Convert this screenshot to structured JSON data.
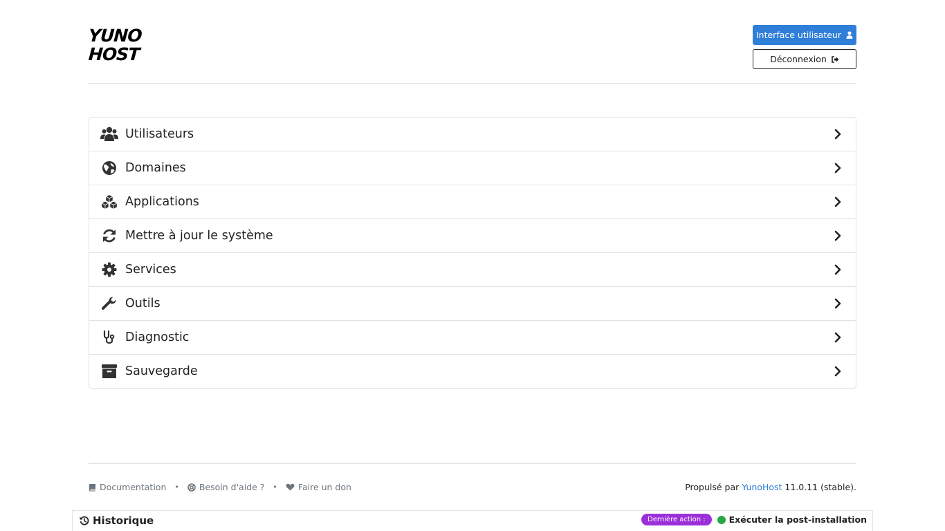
{
  "header": {
    "logo_line1": "YUNO",
    "logo_line2": "HOST",
    "user_interface_label": "Interface utilisateur",
    "logout_label": "Déconnexion"
  },
  "menu": {
    "items": [
      {
        "label": "Utilisateurs",
        "icon": "users-icon"
      },
      {
        "label": "Domaines",
        "icon": "globe-icon"
      },
      {
        "label": "Applications",
        "icon": "cubes-icon"
      },
      {
        "label": "Mettre à jour le système",
        "icon": "refresh-icon"
      },
      {
        "label": "Services",
        "icon": "gear-icon"
      },
      {
        "label": "Outils",
        "icon": "wrench-icon"
      },
      {
        "label": "Diagnostic",
        "icon": "stethoscope-icon"
      },
      {
        "label": "Sauvegarde",
        "icon": "archive-icon"
      }
    ]
  },
  "footer": {
    "documentation": "Documentation",
    "help": "Besoin d'aide ?",
    "donate": "Faire un don",
    "separator": "•",
    "powered_prefix": "Propulsé par",
    "powered_link": "YunoHost",
    "version": "11.0.11 (stable)."
  },
  "history": {
    "title": "Historique",
    "badge": "Dernière action :",
    "last_action": "Exécuter la post-installation"
  },
  "colors": {
    "primary": "#2f7ed8",
    "badge": "#9b30d9",
    "success": "#28a745"
  }
}
